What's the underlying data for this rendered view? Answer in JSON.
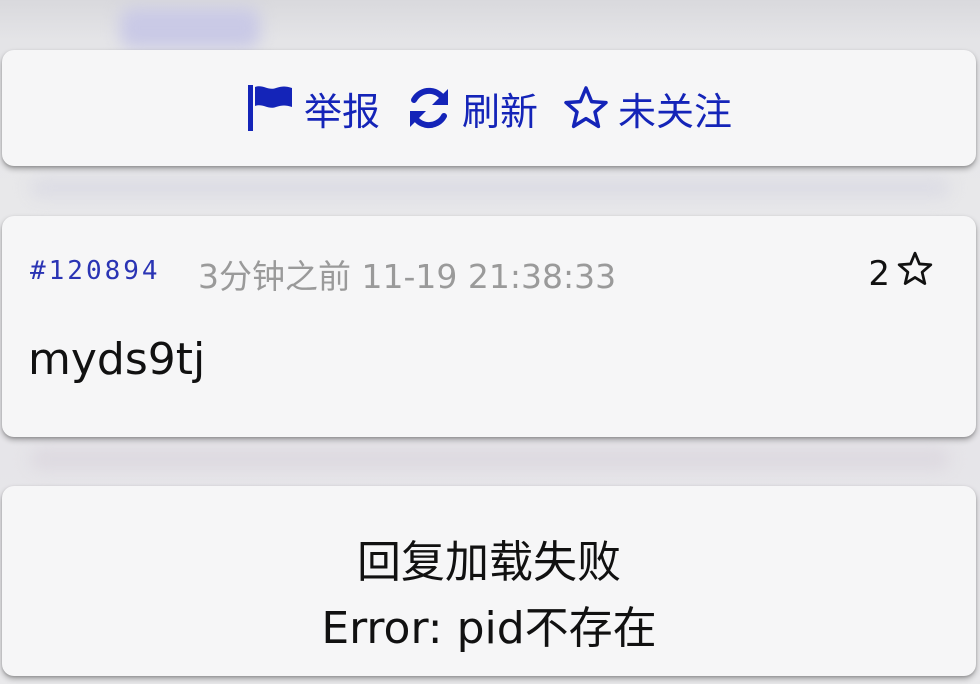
{
  "toolbar": {
    "report_label": "举报",
    "refresh_label": "刷新",
    "follow_label": "未关注",
    "accent_color": "#1424b8"
  },
  "post": {
    "pid": "#120894",
    "relative_time": "3分钟之前",
    "timestamp": "11-19 21:38:33",
    "like_count": "2",
    "text": "myds9tj"
  },
  "replies": {
    "error_title": "回复加载失败",
    "error_message": "Error: pid不存在"
  },
  "icons": {
    "report": "flag-icon",
    "refresh": "refresh-icon",
    "follow": "star-outline-icon",
    "like": "star-outline-icon"
  }
}
